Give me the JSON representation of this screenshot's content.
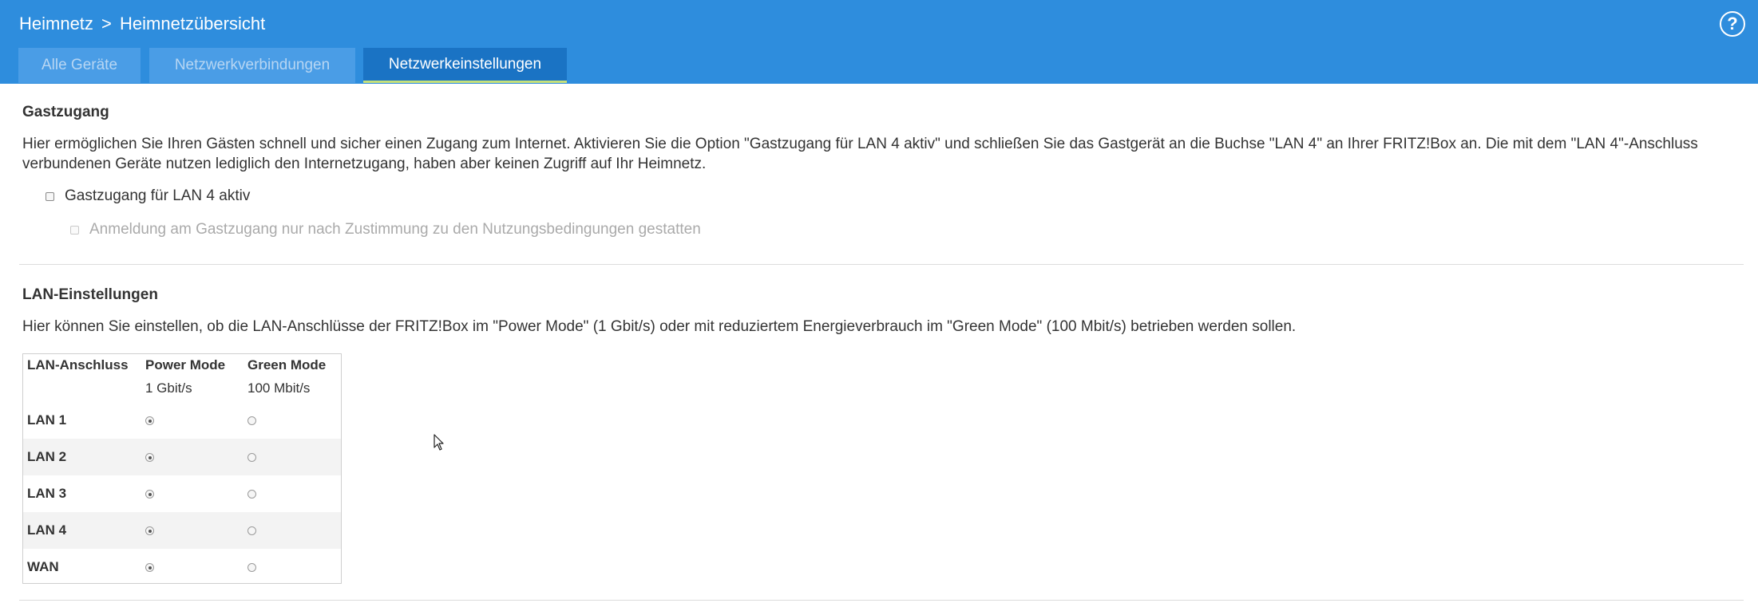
{
  "header": {
    "breadcrumb_parent": "Heimnetz",
    "breadcrumb_separator": ">",
    "breadcrumb_current": "Heimnetzübersicht",
    "help_label": "?",
    "tabs": [
      {
        "label": "Alle Geräte",
        "active": false
      },
      {
        "label": "Netzwerkverbindungen",
        "active": false
      },
      {
        "label": "Netzwerkeinstellungen",
        "active": true
      }
    ]
  },
  "guest": {
    "title": "Gastzugang",
    "description": "Hier ermöglichen Sie Ihren Gästen schnell und sicher einen Zugang zum Internet. Aktivieren Sie die Option \"Gastzugang für LAN 4 aktiv\" und schließen Sie das Gastgerät an die Buchse \"LAN 4\" an Ihrer FRITZ!Box an. Die mit dem \"LAN 4\"-Anschluss verbundenen Geräte nutzen lediglich den Internetzugang, haben aber keinen Zugriff auf Ihr Heimnetz.",
    "lan4_option": {
      "label": "Gastzugang für LAN 4 aktiv",
      "checked": false
    },
    "terms_option": {
      "label": "Anmeldung am Gastzugang nur nach Zustimmung zu den Nutzungsbedingungen gestatten",
      "checked": false,
      "disabled": true
    }
  },
  "lan": {
    "title": "LAN-Einstellungen",
    "description": "Hier können Sie einstellen, ob die LAN-Anschlüsse der FRITZ!Box im \"Power Mode\" (1 Gbit/s) oder mit reduziertem Energieverbrauch im \"Green Mode\" (100 Mbit/s) betrieben werden sollen.",
    "table": {
      "col_port": "LAN-Anschluss",
      "col_power": "Power Mode",
      "col_power_sub": "1 Gbit/s",
      "col_green": "Green Mode",
      "col_green_sub": "100 Mbit/s",
      "rows": [
        {
          "name": "LAN 1",
          "mode": "power"
        },
        {
          "name": "LAN 2",
          "mode": "power"
        },
        {
          "name": "LAN 3",
          "mode": "power"
        },
        {
          "name": "LAN 4",
          "mode": "power"
        },
        {
          "name": "WAN",
          "mode": "power"
        }
      ]
    }
  }
}
